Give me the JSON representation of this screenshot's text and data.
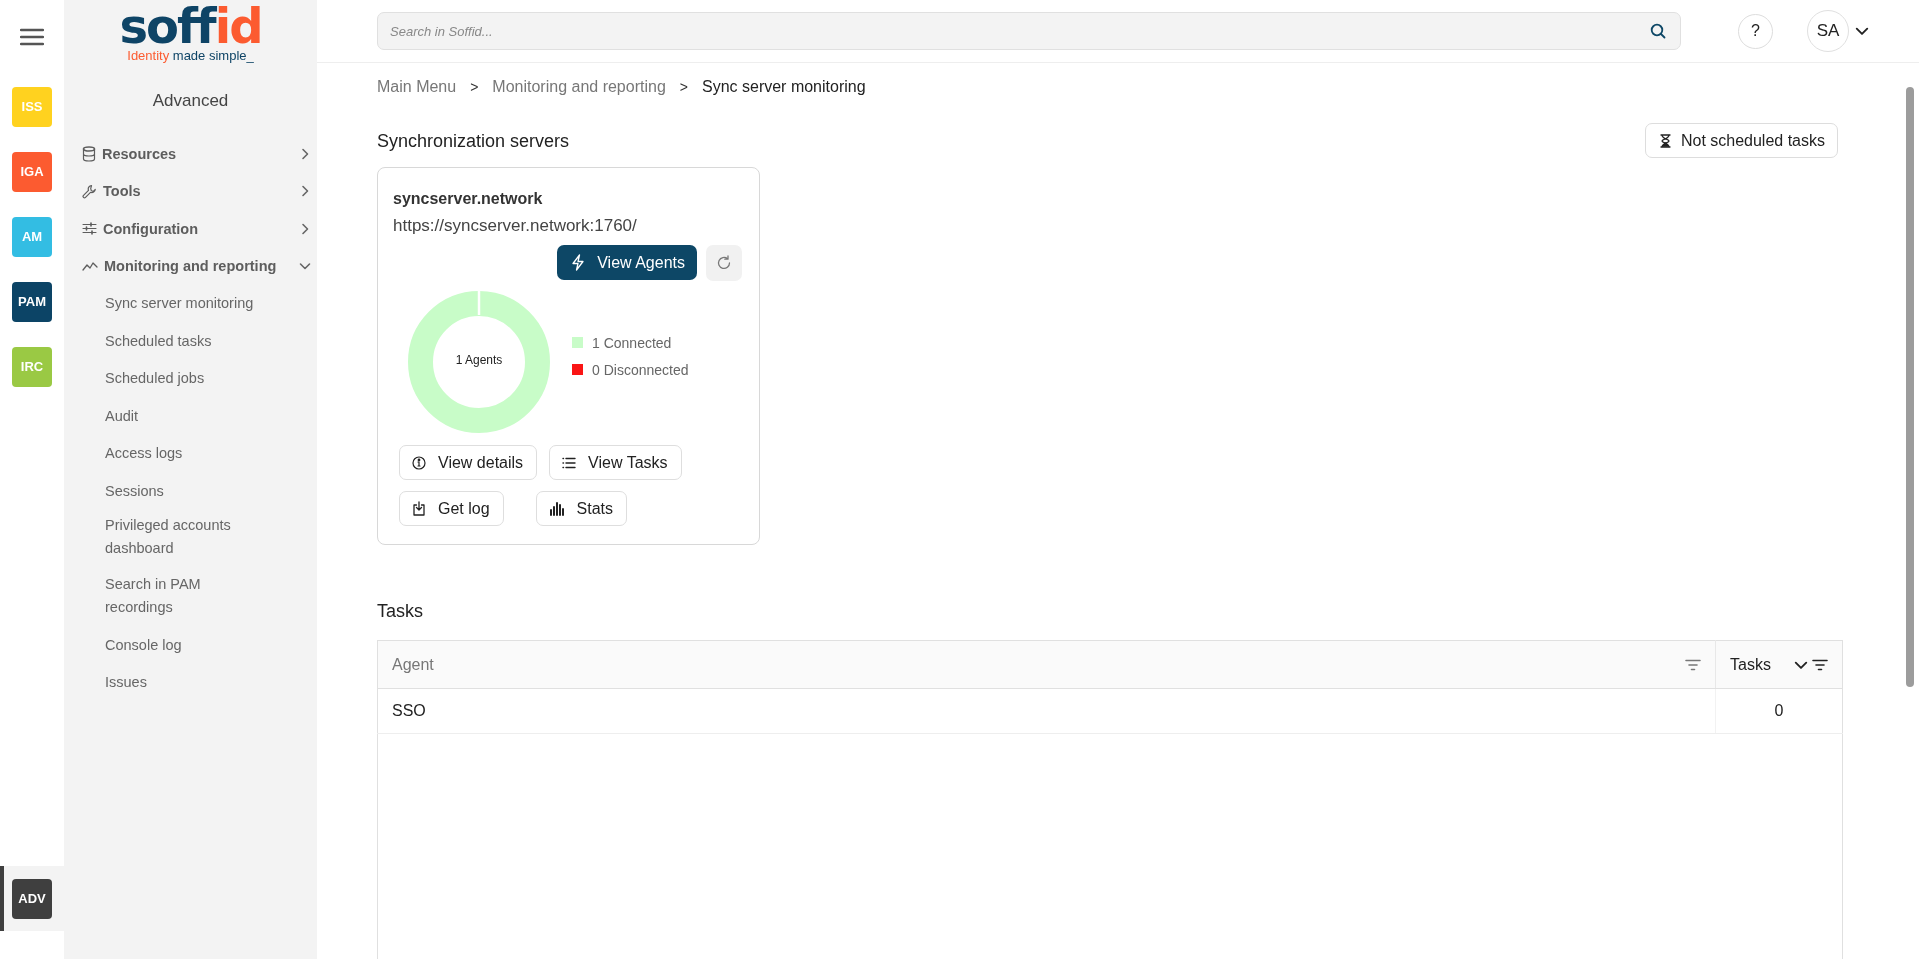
{
  "apps": [
    {
      "label": "ISS",
      "color": "#ffd21f",
      "selected": false
    },
    {
      "label": "IGA",
      "color": "#fc5b30",
      "selected": false
    },
    {
      "label": "AM",
      "color": "#33bde3",
      "selected": false
    },
    {
      "label": "PAM",
      "color": "#0c4466",
      "selected": false
    },
    {
      "label": "IRC",
      "color": "#9ac944",
      "selected": false
    },
    {
      "label": "ADV",
      "color": "#3f3f3f",
      "selected": true
    }
  ],
  "logo": {
    "wordmark": [
      "soff",
      "id"
    ],
    "tagline": [
      "Identity",
      "made simple_"
    ]
  },
  "section_title": "Advanced",
  "nav": [
    {
      "label": "Resources",
      "expanded": false
    },
    {
      "label": "Tools",
      "expanded": false
    },
    {
      "label": "Configuration",
      "expanded": false
    },
    {
      "label": "Monitoring and reporting",
      "expanded": true,
      "children": [
        {
          "label": "Sync server monitoring"
        },
        {
          "label": "Scheduled tasks"
        },
        {
          "label": "Scheduled jobs"
        },
        {
          "label": "Audit"
        },
        {
          "label": "Access logs"
        },
        {
          "label": "Sessions"
        },
        {
          "label": "Privileged accounts dashboard"
        },
        {
          "label": "Search in PAM recordings"
        },
        {
          "label": "Console log"
        },
        {
          "label": "Issues"
        }
      ]
    }
  ],
  "search": {
    "placeholder": "Search in Soffid..."
  },
  "help": "?",
  "user": {
    "initials": "SA"
  },
  "breadcrumb": {
    "separator": ">",
    "items": [
      "Main Menu",
      "Monitoring and reporting",
      "Sync server monitoring"
    ]
  },
  "servers_title": "Synchronization servers",
  "not_scheduled_button": "Not scheduled tasks",
  "servers": [
    {
      "name": "syncserver.network",
      "url": "https://syncserver.network:1760/",
      "view_agents": "View Agents",
      "center_label": "1 Agents",
      "legend": [
        {
          "label": "1 Connected",
          "color": "#c8fcc8"
        },
        {
          "label": "0 Disconnected",
          "color": "#fa1515"
        }
      ],
      "actions": [
        "View details",
        "View Tasks",
        "Get log",
        "Stats"
      ]
    }
  ],
  "tasks": {
    "title": "Tasks",
    "columns": [
      {
        "label": "Agent",
        "sorted": false
      },
      {
        "label": "Tasks",
        "sorted": true
      }
    ],
    "rows": [
      [
        "SSO",
        "0"
      ]
    ]
  }
}
